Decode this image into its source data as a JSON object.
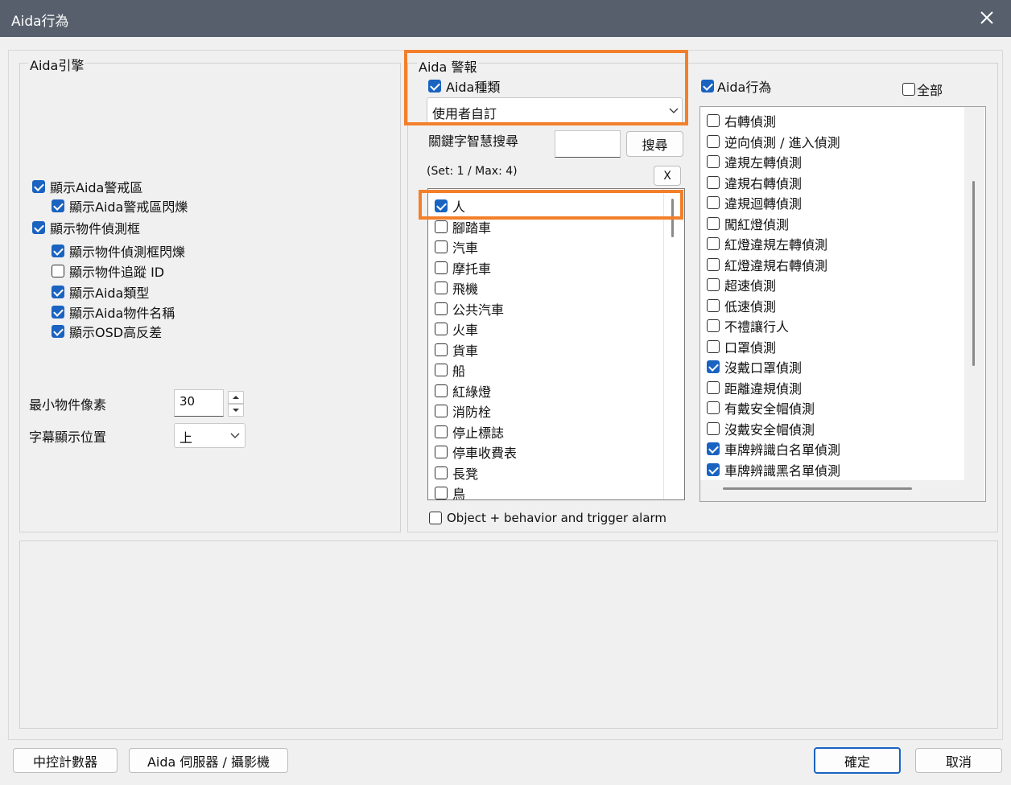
{
  "window": {
    "title": "Aida行為"
  },
  "engine": {
    "legend": "Aida引擎",
    "checks": [
      {
        "label": "顯示Aida警戒區",
        "checked": true
      },
      {
        "label": "顯示Aida警戒區閃爍",
        "checked": true
      },
      {
        "label": "顯示物件偵測框",
        "checked": true
      },
      {
        "label": "顯示物件偵測框閃爍",
        "checked": true
      },
      {
        "label": "顯示物件追蹤 ID",
        "checked": false
      },
      {
        "label": "顯示Aida類型",
        "checked": true
      },
      {
        "label": "顯示Aida物件名稱",
        "checked": true
      },
      {
        "label": "顯示OSD高反差",
        "checked": true
      }
    ],
    "min_pixel_label": "最小物件像素",
    "min_pixel_value": "30",
    "caption_pos_label": "字幕顯示位置",
    "caption_pos_value": "上"
  },
  "alarm": {
    "legend": "Aida 警報",
    "type_check_label": "Aida種類",
    "type_select_value": "使用者自訂",
    "keyword_label": "關鍵字智慧搜尋",
    "search_button": "搜尋",
    "set_info": "(Set: 1 / Max: 4)",
    "clear_button": "X",
    "objects": [
      {
        "label": "人",
        "checked": true
      },
      {
        "label": "腳踏車",
        "checked": false
      },
      {
        "label": "汽車",
        "checked": false
      },
      {
        "label": "摩托車",
        "checked": false
      },
      {
        "label": "飛機",
        "checked": false
      },
      {
        "label": "公共汽車",
        "checked": false
      },
      {
        "label": "火車",
        "checked": false
      },
      {
        "label": "貨車",
        "checked": false
      },
      {
        "label": "船",
        "checked": false
      },
      {
        "label": "紅綠燈",
        "checked": false
      },
      {
        "label": "消防栓",
        "checked": false
      },
      {
        "label": "停止標誌",
        "checked": false
      },
      {
        "label": "停車收費表",
        "checked": false
      },
      {
        "label": "長凳",
        "checked": false
      },
      {
        "label": "鳥",
        "checked": false
      }
    ],
    "trigger_label": "Object + behavior and trigger alarm"
  },
  "behavior": {
    "check_label": "Aida行為",
    "all_label": "全部",
    "items": [
      {
        "label": "右轉偵測",
        "checked": false
      },
      {
        "label": "逆向偵測 / 進入偵測",
        "checked": false
      },
      {
        "label": "違規左轉偵測",
        "checked": false
      },
      {
        "label": "違規右轉偵測",
        "checked": false
      },
      {
        "label": "違規迴轉偵測",
        "checked": false
      },
      {
        "label": "闖紅燈偵測",
        "checked": false
      },
      {
        "label": "紅燈違規左轉偵測",
        "checked": false
      },
      {
        "label": "紅燈違規右轉偵測",
        "checked": false
      },
      {
        "label": "超速偵測",
        "checked": false
      },
      {
        "label": "低速偵測",
        "checked": false
      },
      {
        "label": "不禮讓行人",
        "checked": false
      },
      {
        "label": "口罩偵測",
        "checked": false
      },
      {
        "label": "沒戴口罩偵測",
        "checked": true
      },
      {
        "label": "距離違規偵測",
        "checked": false
      },
      {
        "label": "有戴安全帽偵測",
        "checked": false
      },
      {
        "label": "沒戴安全帽偵測",
        "checked": false
      },
      {
        "label": "車牌辨識白名單偵測",
        "checked": true
      },
      {
        "label": "車牌辨識黑名單偵測",
        "checked": true
      }
    ]
  },
  "footer": {
    "counter_button": "中控計數器",
    "server_button": "Aida 伺服器 / 攝影機",
    "ok_button": "確定",
    "cancel_button": "取消"
  },
  "colors": {
    "accent": "#1a63c1",
    "highlight": "#f37f2a",
    "titlebar": "#565f6b"
  }
}
